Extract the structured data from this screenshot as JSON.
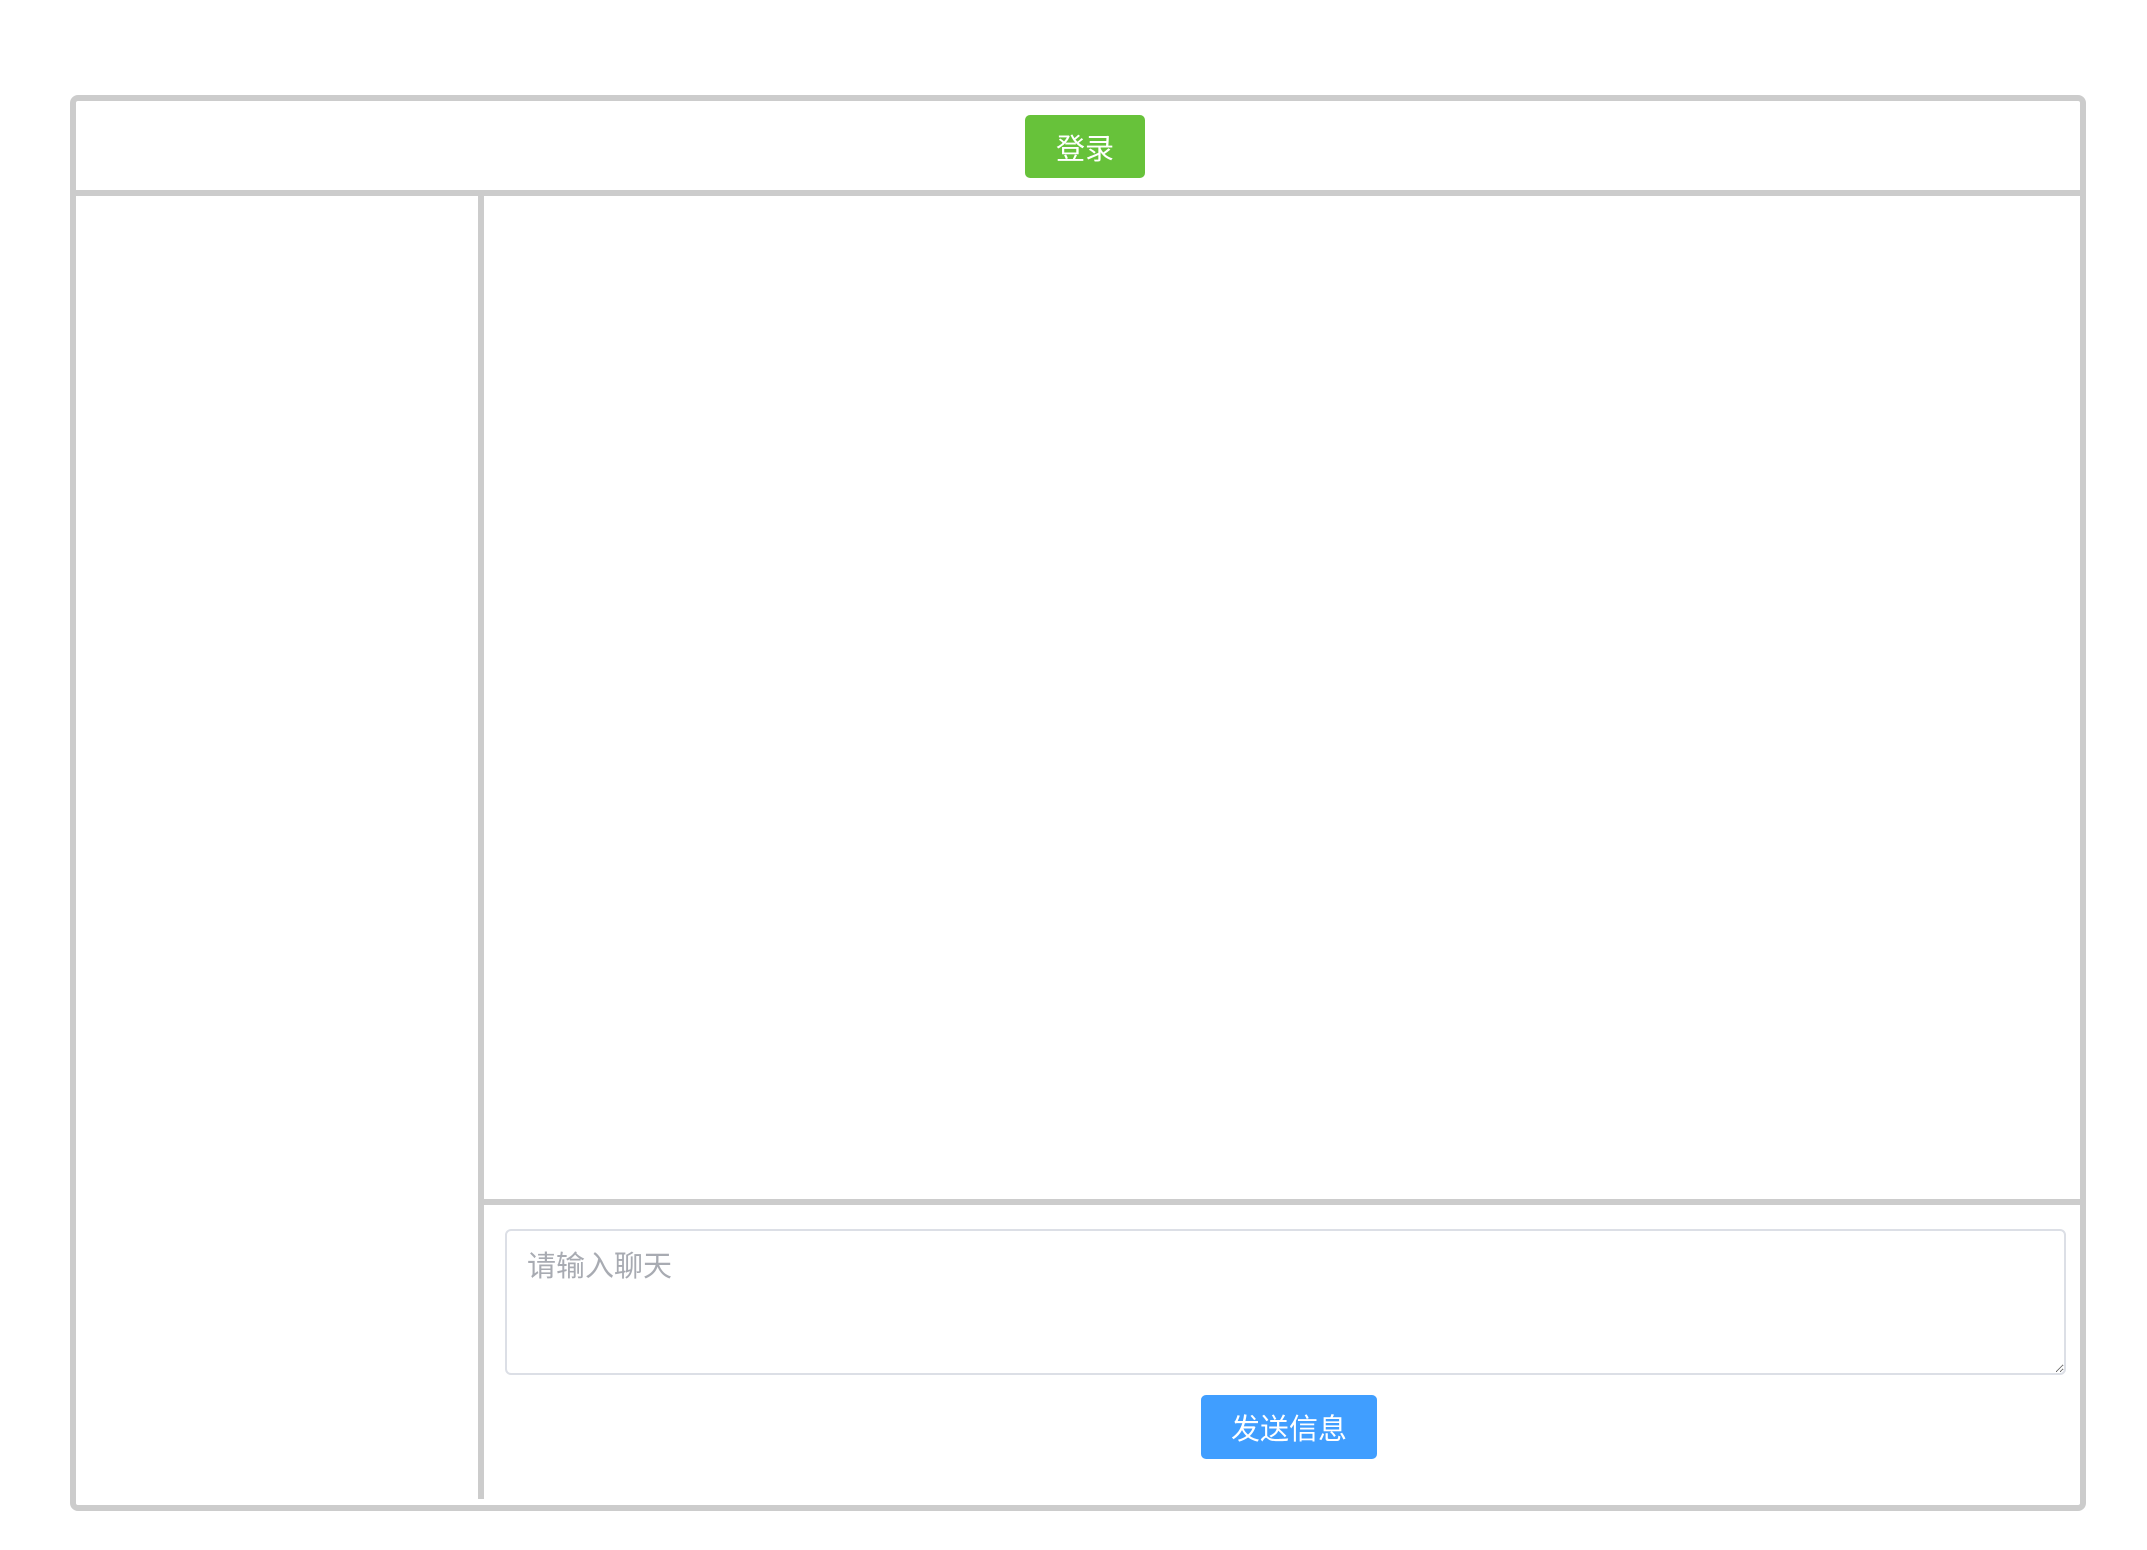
{
  "header": {
    "login_label": "登录"
  },
  "composer": {
    "placeholder": "请输入聊天",
    "value": "",
    "send_label": "发送信息"
  },
  "colors": {
    "login_button": "#67c23a",
    "send_button": "#409eff",
    "border": "#cccccc"
  }
}
